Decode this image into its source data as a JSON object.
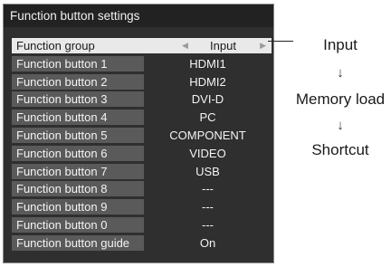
{
  "window": {
    "title": "Function button settings"
  },
  "rows": [
    {
      "label": "Function group",
      "value": "Input"
    },
    {
      "label": "Function button 1",
      "value": "HDMI1"
    },
    {
      "label": "Function button 2",
      "value": "HDMI2"
    },
    {
      "label": "Function button 3",
      "value": "DVI-D"
    },
    {
      "label": "Function button 4",
      "value": "PC"
    },
    {
      "label": "Function button 5",
      "value": "COMPONENT"
    },
    {
      "label": "Function button 6",
      "value": "VIDEO"
    },
    {
      "label": "Function button 7",
      "value": "USB"
    },
    {
      "label": "Function button 8",
      "value": "---"
    },
    {
      "label": "Function button 9",
      "value": "---"
    },
    {
      "label": "Function button 0",
      "value": "---"
    },
    {
      "label": "Function button guide",
      "value": "On"
    }
  ],
  "flow": {
    "options": [
      "Input",
      "Memory load",
      "Shortcut"
    ],
    "arrow": "↓"
  },
  "icons": {
    "left": "triangle-left-icon",
    "right": "triangle-right-icon"
  },
  "colors": {
    "panel": "#2f2f2f",
    "row_label": "#5a5a5a",
    "selected": "#e9e9e9"
  }
}
